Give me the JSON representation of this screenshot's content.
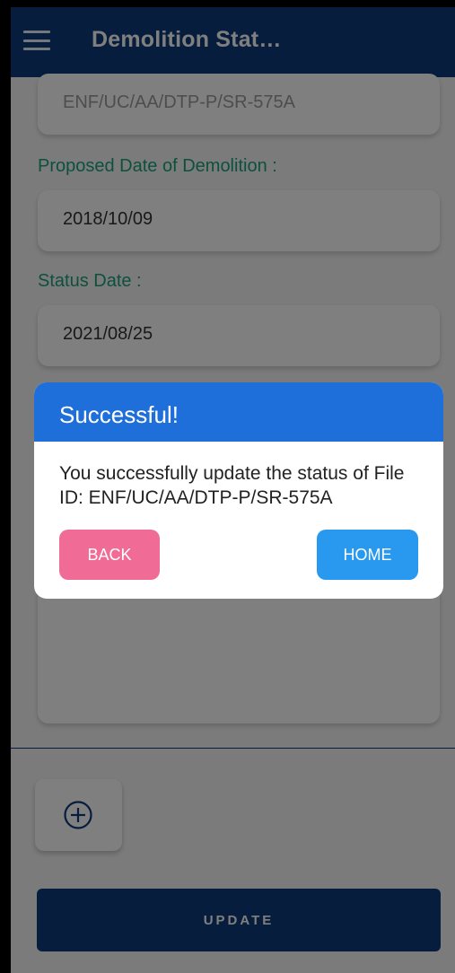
{
  "appbar": {
    "title": "Demolition Stat…",
    "menu_icon": "hamburger-menu-icon",
    "background": "#0d3a7a"
  },
  "form": {
    "file_id_value": "ENF/UC/AA/DTP-P/SR-575A",
    "proposed_date_label": "Proposed Date of Demolition :",
    "proposed_date_value": "2018/10/09",
    "status_date_label": "Status Date :",
    "status_date_value": "2021/08/25",
    "label_color": "#1aa37a",
    "add_icon": "plus-circle-icon",
    "update_label": "UPDATE"
  },
  "dialog": {
    "title": "Successful!",
    "message": "You successfully update the status of File ID: ENF/UC/AA/DTP-P/SR-575A",
    "back_label": "BACK",
    "home_label": "HOME",
    "header_color": "#1f6fdb",
    "back_color": "#f06c97",
    "home_color": "#2899ef"
  }
}
